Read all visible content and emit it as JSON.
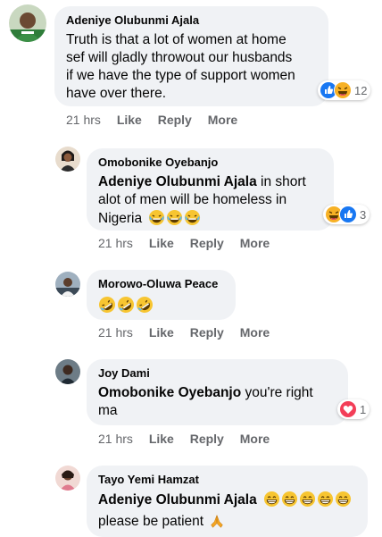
{
  "colors": {
    "bubble": "#f0f2f5",
    "text": "#050505",
    "muted": "#65676b",
    "like_blue": "#1877f2",
    "love_red": "#f33e58",
    "haha_yellow": "#f7b125"
  },
  "comments": [
    {
      "author": "Adeniye Olubunmi Ajala",
      "lines": [
        "Truth is that a lot of women at home",
        "sef will gladly throwout our husbands",
        "if we have the type of support women",
        "have over there."
      ],
      "reaction_icons": [
        "like-icon",
        "haha-icon"
      ],
      "reaction_count": "12",
      "time": "21 hrs",
      "like": "Like",
      "reply": "Reply",
      "more": "More"
    },
    {
      "author": "Omobonike Oyebanjo",
      "mention": "Adeniye Olubunmi Ajala",
      "line1_rest": " in short",
      "line2": "alot of men will be homeless in",
      "line3": "Nigeria",
      "line3_emojis": [
        "laughing-tears-emoji",
        "laughing-tears-emoji",
        "laughing-tears-emoji"
      ],
      "reaction_icons": [
        "haha-icon",
        "like-icon"
      ],
      "reaction_count": "3",
      "time": "21 hrs",
      "like": "Like",
      "reply": "Reply",
      "more": "More"
    },
    {
      "author": "Morowo-Oluwa Peace",
      "emojis": [
        "rofl-emoji",
        "rofl-emoji",
        "rofl-emoji"
      ],
      "time": "21 hrs",
      "like": "Like",
      "reply": "Reply",
      "more": "More"
    },
    {
      "author": "Joy Dami",
      "mention": "Omobonike Oyebanjo",
      "line1_rest": " you're right",
      "line2": "ma",
      "reaction_icons": [
        "love-icon"
      ],
      "reaction_count": "1",
      "time": "21 hrs",
      "like": "Like",
      "reply": "Reply",
      "more": "More"
    },
    {
      "author": "Tayo Yemi Hamzat",
      "mention": "Adeniye Olubunmi Ajala",
      "line1_emojis": [
        "grinning-emoji",
        "grinning-emoji",
        "grinning-emoji",
        "grinning-emoji",
        "grinning-emoji"
      ],
      "line2": "please be patient",
      "line2_emoji": "folded-hands-emoji"
    }
  ]
}
